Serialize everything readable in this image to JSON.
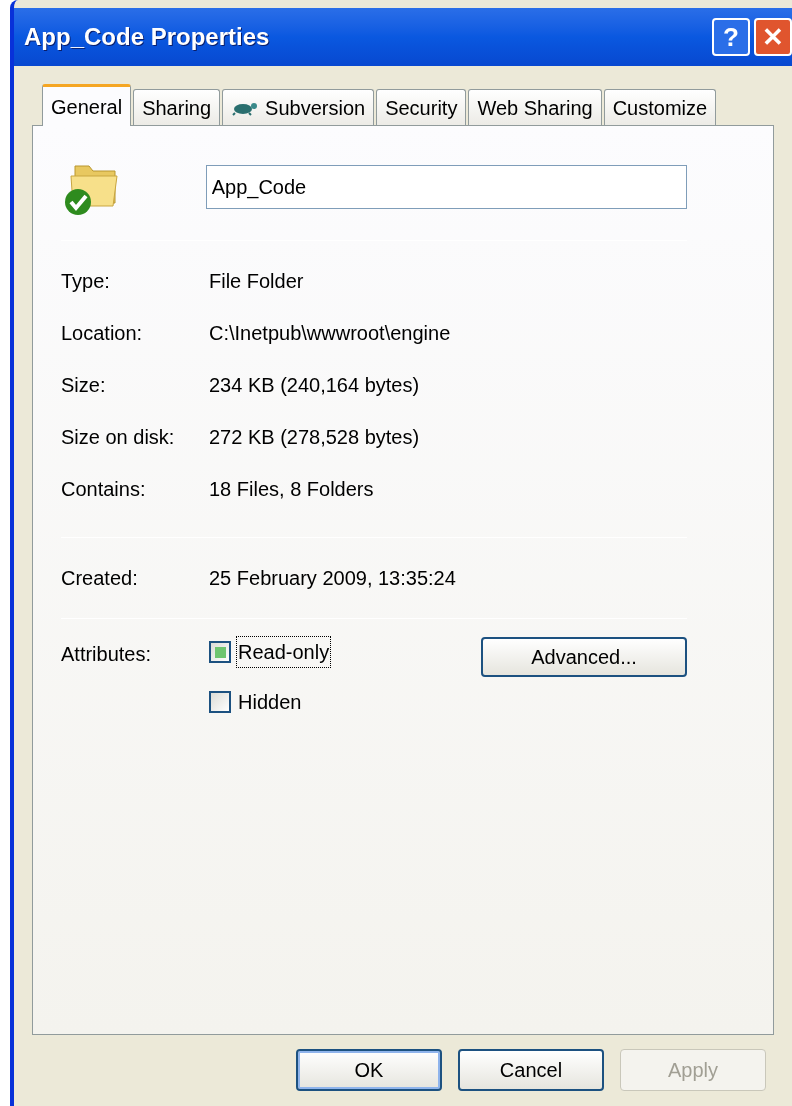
{
  "window": {
    "title": "App_Code Properties",
    "title_buttons": [
      {
        "kind": "help",
        "label": "?"
      },
      {
        "kind": "close",
        "label": "✕"
      }
    ]
  },
  "tabs": [
    {
      "label": "General",
      "selected": true
    },
    {
      "label": "Sharing",
      "selected": false
    },
    {
      "label": "Subversion",
      "selected": false,
      "kind": "icon"
    },
    {
      "label": "Security",
      "selected": false
    },
    {
      "label": "Web Sharing",
      "selected": false
    },
    {
      "label": "Customize",
      "selected": false
    }
  ],
  "name_field": {
    "value": "App_Code"
  },
  "info_groups": [
    [
      {
        "label": "Type:",
        "value": "File Folder"
      },
      {
        "label": "Location:",
        "value": "C:\\Inetpub\\wwwroot\\engine"
      },
      {
        "label": "Size:",
        "value": "234 KB (240,164 bytes)"
      },
      {
        "label": "Size on disk:",
        "value": "272 KB (278,528 bytes)"
      },
      {
        "label": "Contains:",
        "value": "18 Files, 8 Folders"
      }
    ],
    [
      {
        "label": "Created:",
        "value": "25 February 2009, 13:35:24"
      }
    ]
  ],
  "attributes": {
    "label": "Attributes:",
    "checkboxes": [
      {
        "label": "Read-only",
        "checked": true,
        "indeterminate": true,
        "focused": true
      },
      {
        "label": "Hidden",
        "checked": false,
        "indeterminate": false,
        "focused": false
      }
    ],
    "advanced_button": "Advanced..."
  },
  "buttons": [
    {
      "label": "OK",
      "disabled": false,
      "default": true
    },
    {
      "label": "Cancel",
      "disabled": false,
      "default": false
    },
    {
      "label": "Apply",
      "disabled": true,
      "default": false
    }
  ]
}
